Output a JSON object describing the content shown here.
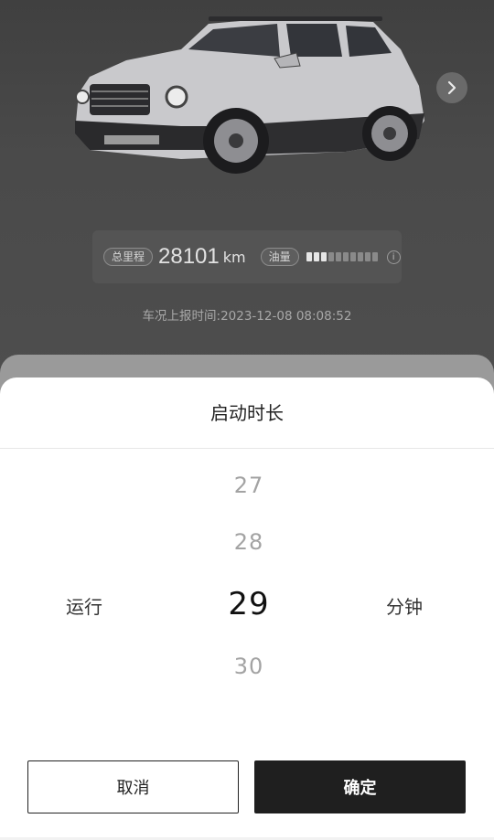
{
  "vehicle": {
    "mileage_label": "总里程",
    "mileage_value": "28101",
    "mileage_unit": "km",
    "fuel_label": "油量",
    "fuel_level_fraction": 0.3,
    "report_time": "车况上报时间:2023-12-08 08:08:52"
  },
  "sheet": {
    "title": "启动时长",
    "left_label": "运行",
    "right_label": "分钟",
    "options": [
      "27",
      "28",
      "29",
      "30"
    ],
    "selected": "29",
    "cancel_label": "取消",
    "confirm_label": "确定"
  },
  "icons": {
    "next": "chevron-right-icon",
    "info": "info-icon"
  }
}
